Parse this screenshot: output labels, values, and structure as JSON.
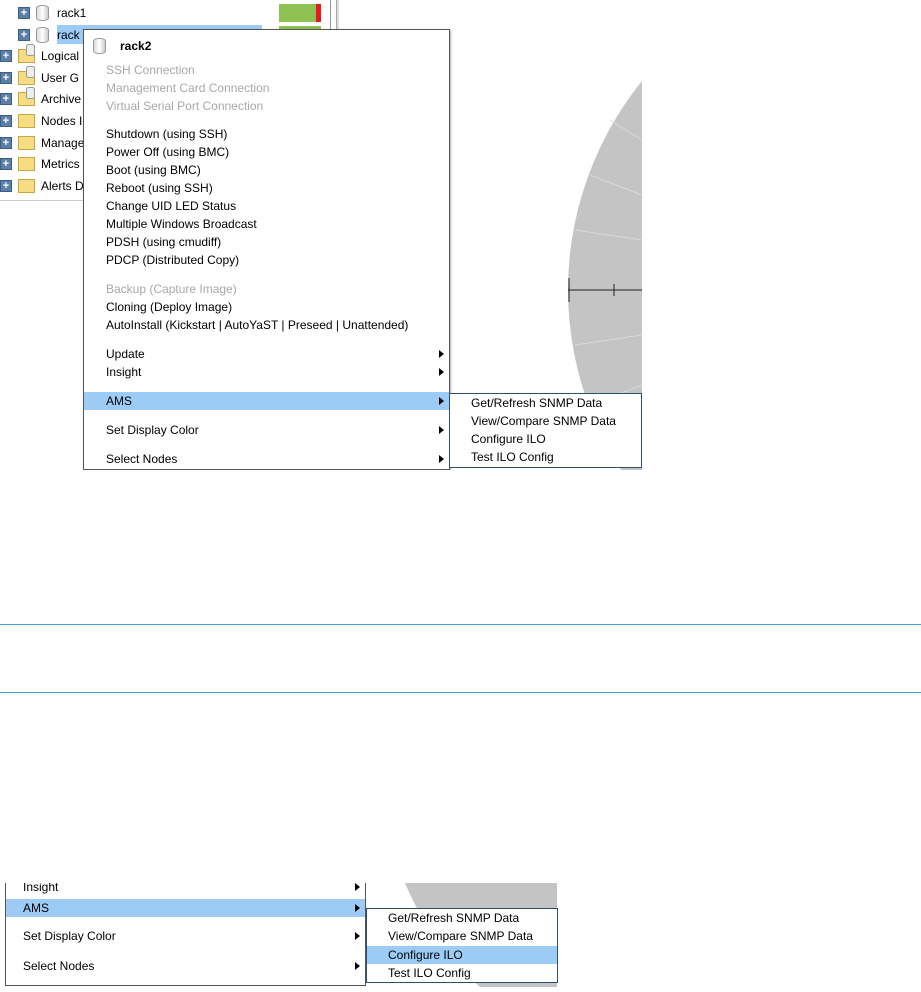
{
  "tree": {
    "items": [
      {
        "label": "rack1",
        "type": "rack"
      },
      {
        "label": "rack",
        "type": "rack",
        "selected": true
      },
      {
        "label": "Logical",
        "type": "folder-db"
      },
      {
        "label": "User G",
        "type": "folder-db"
      },
      {
        "label": "Archive",
        "type": "folder-db"
      },
      {
        "label": "Nodes I",
        "type": "folder"
      },
      {
        "label": "Manage",
        "type": "folder"
      },
      {
        "label": "Metrics",
        "type": "folder"
      },
      {
        "label": "Alerts D",
        "type": "folder"
      }
    ],
    "status_colors": {
      "ok": "#8dc152",
      "alert": "#e8191c"
    }
  },
  "context_menu": {
    "title": "rack2",
    "items": [
      {
        "label": "SSH Connection",
        "disabled": true
      },
      {
        "label": "Management Card Connection",
        "disabled": true
      },
      {
        "label": "Virtual Serial Port Connection",
        "disabled": true
      },
      {
        "label": "Shutdown (using SSH)"
      },
      {
        "label": "Power Off (using BMC)"
      },
      {
        "label": "Boot (using BMC)"
      },
      {
        "label": "Reboot (using SSH)"
      },
      {
        "label": "Change UID LED Status"
      },
      {
        "label": "Multiple Windows Broadcast"
      },
      {
        "label": "PDSH (using cmudiff)"
      },
      {
        "label": "PDCP (Distributed Copy)"
      },
      {
        "label": "Backup (Capture Image)",
        "disabled": true
      },
      {
        "label": "Cloning (Deploy Image)"
      },
      {
        "label": "AutoInstall (Kickstart | AutoYaST | Preseed | Unattended)"
      },
      {
        "label": "Update",
        "submenu": true
      },
      {
        "label": "Insight",
        "submenu": true
      },
      {
        "label": "AMS",
        "submenu": true,
        "highlighted": true
      },
      {
        "label": "Set Display Color",
        "submenu": true
      },
      {
        "label": "Select Nodes",
        "submenu": true
      }
    ]
  },
  "ams_submenu": {
    "items": [
      "Get/Refresh SNMP Data",
      "View/Compare SNMP Data",
      "Configure ILO",
      "Test ILO Config"
    ]
  },
  "detail": {
    "menu_items": [
      "Insight",
      "AMS",
      "Set Display Color",
      "Select Nodes"
    ],
    "highlighted_menu": "AMS",
    "submenu_items": [
      "Get/Refresh SNMP Data",
      "View/Compare SNMP Data",
      "Configure ILO",
      "Test ILO Config"
    ],
    "highlighted_submenu": "Configure ILO"
  },
  "colors": {
    "highlight": "#9ccbf5",
    "divider": "#4a9fd6",
    "disc": "#c4c4c4"
  }
}
